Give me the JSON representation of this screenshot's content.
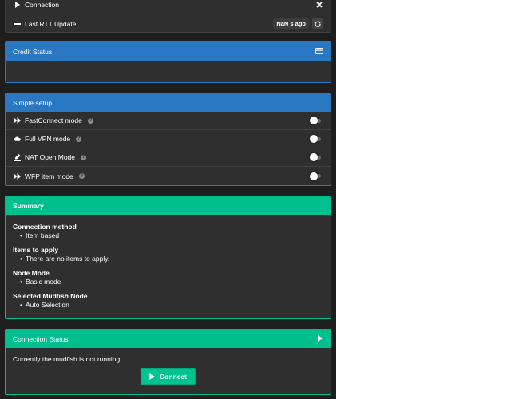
{
  "connection": {
    "label": "Connection",
    "rtt_label": "Last RTT Update",
    "rtt_badge": "NaN s ago"
  },
  "credit": {
    "title": "Credit Status",
    "color": "#2b78c2"
  },
  "simple_setup": {
    "title": "Simple setup",
    "color": "#2b78c2",
    "items": [
      {
        "label": "FastConnect mode",
        "icon": "fast-forward-icon",
        "enabled": false
      },
      {
        "label": "Full VPN mode",
        "icon": "cloud-icon",
        "enabled": false
      },
      {
        "label": "NAT Open Mode",
        "icon": "pencil-icon",
        "enabled": false
      },
      {
        "label": "WFP item mode",
        "icon": "fast-forward-icon",
        "enabled": false
      }
    ]
  },
  "summary": {
    "title": "Summary",
    "color": "#00bf8f",
    "sections": [
      {
        "heading": "Connection method",
        "value": "Item based"
      },
      {
        "heading": "Items to apply",
        "value": "There are no items to apply."
      },
      {
        "heading": "Node Mode",
        "value": "Basic mode"
      },
      {
        "heading": "Selected Mudfish Node",
        "value": "Auto Selection"
      }
    ]
  },
  "connection_status": {
    "title": "Connection Status",
    "color": "#00bf8f",
    "message": "Currently the mudfish is not running.",
    "button": "Connect"
  }
}
